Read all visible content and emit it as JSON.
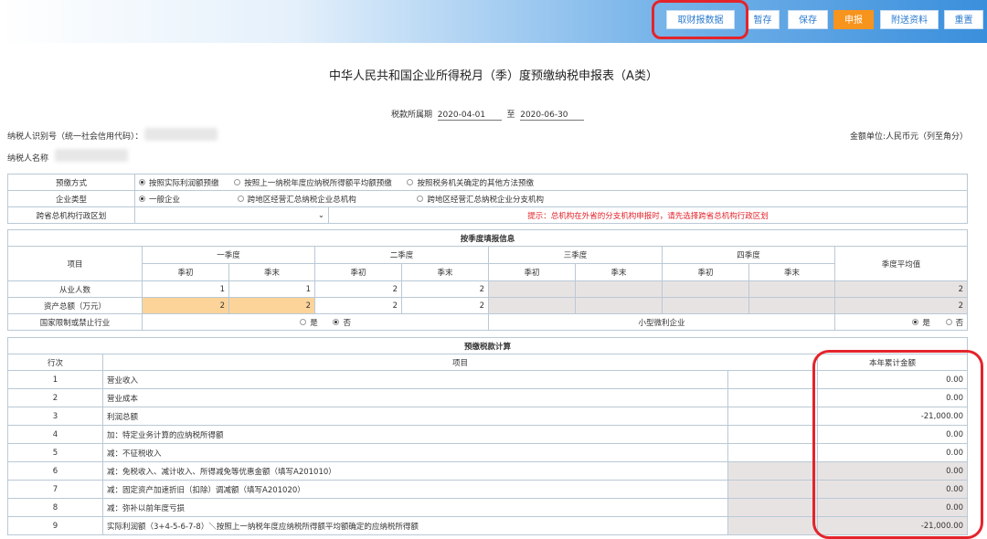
{
  "toolbar": {
    "fetch_report": "取财报数据",
    "temp_save": "暂存",
    "save": "保存",
    "declare": "申报",
    "attach": "附送资料",
    "reset": "重置"
  },
  "form": {
    "title": "中华人民共和国企业所得税月（季）度预缴纳税申报表（A类）",
    "period_label": "税款所属期",
    "period_start": "2020-04-01",
    "period_to": "至",
    "period_end": "2020-06-30",
    "taxpayer_id_label": "纳税人识别号（统一社会信用代码）：",
    "taxpayer_name_label": "纳税人名称",
    "unit_label": "金额单位:人民币元（列至角分）"
  },
  "basic": {
    "prepay_method_label": "预缴方式",
    "prepay_options": [
      "按照实际利润额预缴",
      "按照上一纳税年度应纳税所得额平均额预缴",
      "按照税务机关确定的其他方法预缴"
    ],
    "enterprise_type_label": "企业类型",
    "enterprise_options": [
      "一般企业",
      "跨地区经营汇总纳税企业总机构",
      "跨地区经营汇总纳税企业分支机构"
    ],
    "cross_region_label": "跨省总机构行政区划",
    "chevron": "⌄",
    "hint": "提示：总机构在外省的分支机构申报时，请先选择跨省总机构行政区划"
  },
  "quarter": {
    "section_title": "按季度填报信息",
    "item_header": "项目",
    "q1": "一季度",
    "q2": "二季度",
    "q3": "三季度",
    "q4": "四季度",
    "start": "季初",
    "end": "季末",
    "avg": "季度平均值",
    "employees_label": "从业人数",
    "employees": [
      "1",
      "1",
      "2",
      "2",
      "",
      "",
      "",
      "",
      "2"
    ],
    "assets_label": "资产总额（万元）",
    "assets": [
      "2",
      "2",
      "2",
      "2",
      "",
      "",
      "",
      "",
      "2"
    ],
    "restricted_label": "国家限制或禁止行业",
    "yes": "是",
    "no": "否",
    "small_label": "小型微利企业"
  },
  "calc": {
    "section_title": "预缴税款计算",
    "row_header": "行次",
    "item_header": "项目",
    "amount_header": "本年累计金额",
    "rows": [
      {
        "no": "1",
        "item": "营业收入",
        "amount": "0.00"
      },
      {
        "no": "2",
        "item": "营业成本",
        "amount": "0.00"
      },
      {
        "no": "3",
        "item": "利润总额",
        "amount": "-21,000.00"
      },
      {
        "no": "4",
        "item": "加：特定业务计算的应纳税所得额",
        "amount": "0.00"
      },
      {
        "no": "5",
        "item": "减：不征税收入",
        "amount": "0.00"
      },
      {
        "no": "6",
        "item": "减：免税收入、减计收入、所得减免等优惠金额（填写A201010）",
        "amount": "0.00"
      },
      {
        "no": "7",
        "item": "减：固定资产加速折旧（扣除）调减额（填写A201020）",
        "amount": "0.00"
      },
      {
        "no": "8",
        "item": "减：弥补以前年度亏损",
        "amount": "0.00"
      },
      {
        "no": "9",
        "item": "实际利润额（3+4-5-6-7-8）＼按照上一纳税年度应纳税所得额平均额确定的应纳税所得额",
        "amount": "-21,000.00"
      }
    ]
  }
}
